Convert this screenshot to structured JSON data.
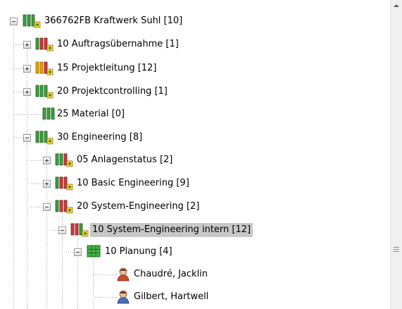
{
  "tree": {
    "nodes": [
      {
        "label": "366762FB Kraftwerk Suhl [10]",
        "icon": "traffic-light-icon",
        "colors": [
          "#3c9e3c",
          "#3c9e3c",
          "#3c9e3c"
        ]
      },
      {
        "label": "10 Auftragsübernahme [1]",
        "icon": "traffic-light-icon",
        "colors": [
          "#3c9e3c",
          "#d03a3a",
          "#d03a3a"
        ]
      },
      {
        "label": "15 Projektleitung [12]",
        "icon": "traffic-light-icon",
        "colors": [
          "#e8a400",
          "#e8a400",
          "#d03a3a"
        ]
      },
      {
        "label": "20 Projektcontrolling [1]",
        "icon": "traffic-light-icon",
        "colors": [
          "#3c9e3c",
          "#3c9e3c",
          "#3c9e3c"
        ]
      },
      {
        "label": "25 Material [0]",
        "icon": "traffic-light-icon",
        "colors": [
          "#3c9e3c",
          "#3c9e3c",
          "#3c9e3c"
        ]
      },
      {
        "label": "30 Engineering [8]",
        "icon": "traffic-light-icon",
        "colors": [
          "#3c9e3c",
          "#3c9e3c",
          "#3c9e3c"
        ]
      },
      {
        "label": "05 Anlagenstatus [2]",
        "icon": "traffic-light-icon",
        "colors": [
          "#3c9e3c",
          "#3c9e3c",
          "#d03a3a"
        ]
      },
      {
        "label": "10 Basic Engineering [9]",
        "icon": "traffic-light-icon",
        "colors": [
          "#3c9e3c",
          "#d03a3a",
          "#d03a3a"
        ]
      },
      {
        "label": "20 System-Engineering [2]",
        "icon": "traffic-light-icon",
        "colors": [
          "#3c9e3c",
          "#d03a3a",
          "#d03a3a"
        ]
      },
      {
        "label": "10 System-Engineering intern [12]",
        "icon": "traffic-light-icon",
        "colors": [
          "#d03a3a",
          "#d03a3a",
          "#3c9e3c"
        ]
      },
      {
        "label": "10 Planung [4]",
        "icon": "grid-table-icon",
        "colors": [
          "#44b244"
        ]
      },
      {
        "label": "Chaudré, Jacklin",
        "icon": "person-icon",
        "colors": [
          "#d04a2a"
        ]
      },
      {
        "label": "Gilbert, Hartwell",
        "icon": "person-icon",
        "colors": [
          "#4a6fb0"
        ]
      }
    ]
  },
  "scrollbar": {
    "up_icon": "arrow-up-icon",
    "grip_icon": "scroll-grip-icon"
  }
}
